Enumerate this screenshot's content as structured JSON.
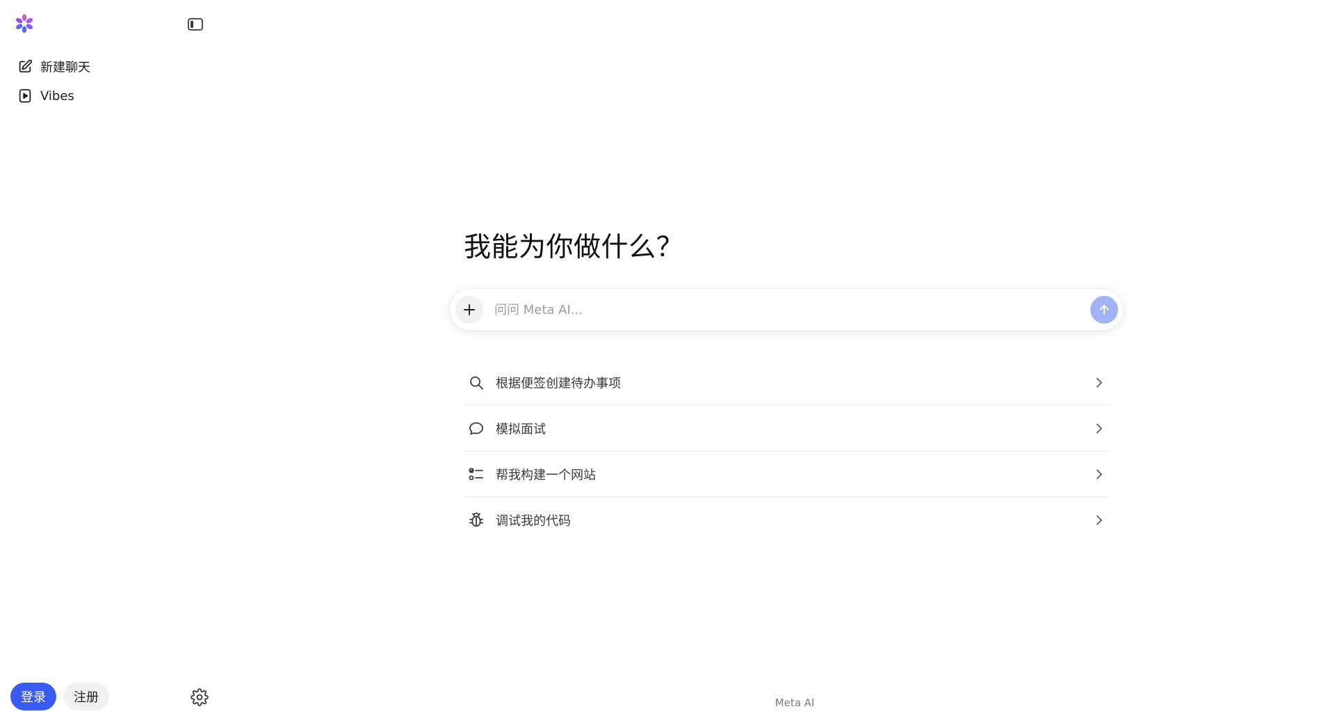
{
  "sidebar": {
    "logo_icon": "meta-ai-logo",
    "collapse_icon": "sidebar-toggle-icon",
    "items": [
      {
        "label": "新建聊天",
        "icon": "edit-icon"
      },
      {
        "label": "Vibes",
        "icon": "play-icon"
      }
    ],
    "login_label": "登录",
    "signup_label": "注册",
    "settings_icon": "gear-icon"
  },
  "main": {
    "headline": "我能为你做什么？",
    "composer": {
      "placeholder": "问问 Meta AI...",
      "value": ""
    },
    "suggestions": [
      {
        "label": "根据便签创建待办事项",
        "icon": "search-icon"
      },
      {
        "label": "模拟面试",
        "icon": "chat-bubble-icon"
      },
      {
        "label": "帮我构建一个网站",
        "icon": "checklist-icon"
      },
      {
        "label": "调试我的代码",
        "icon": "bug-icon"
      }
    ],
    "footer": "Meta AI"
  },
  "colors": {
    "accent": "#3a5bf0",
    "send_button": "#a3b1f5",
    "logo_purple": "#8b4bd8",
    "logo_blue": "#4d6cf2"
  }
}
